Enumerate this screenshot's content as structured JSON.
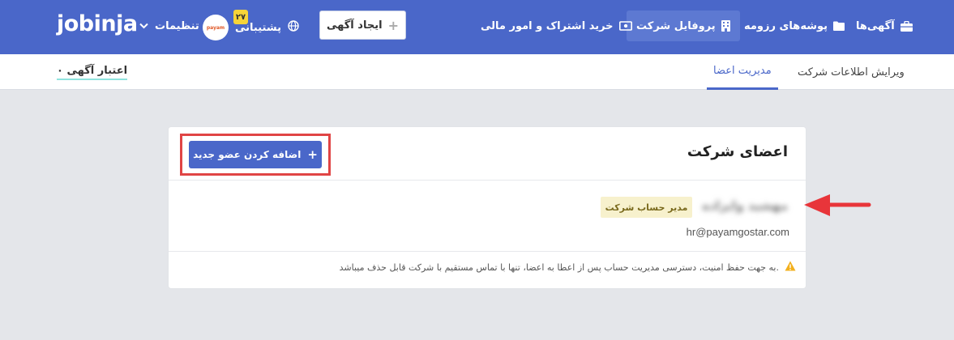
{
  "brand": {
    "logo": "jobinja"
  },
  "topnav": {
    "jobs": "آگهی‌ها",
    "resumes": "پوشه‌های رزومه",
    "company_profile": "پروفایل شرکت",
    "billing": "خرید اشتراک و امور مالی",
    "create_job": "ایجاد آگهی",
    "support": "پشتیبانی",
    "support_count": "۲۷",
    "settings": "تنظیمات"
  },
  "subnav": {
    "edit_info": "ویرایش اطلاعات شرکت",
    "manage_members": "مدیریت اعضا",
    "credit": "۰ اعتبار آگهی"
  },
  "members_card": {
    "title": "اعضای شرکت",
    "add_button": "اضافه کردن عضو جدید",
    "member": {
      "name": "مهشید وایزاده",
      "role": "مدیر حساب شرکت",
      "email": "hr@payamgostar.com"
    },
    "notice": "به جهت حفظ امنیت، دسترسی مدیریت حساب پس از اعطا به اعضا، تنها با تماس مستقیم با شرکت قابل حذف میباشد."
  },
  "colors": {
    "header": "#4a67c9",
    "badge": "#f7f1cd",
    "highlight": "#e04545",
    "arrow": "#e8353a"
  },
  "icons": [
    "briefcase-icon",
    "folder-icon",
    "building-icon",
    "cash-icon",
    "plus-icon",
    "globe-icon",
    "chevron-down-icon",
    "warning-icon",
    "arrow-left-icon"
  ]
}
